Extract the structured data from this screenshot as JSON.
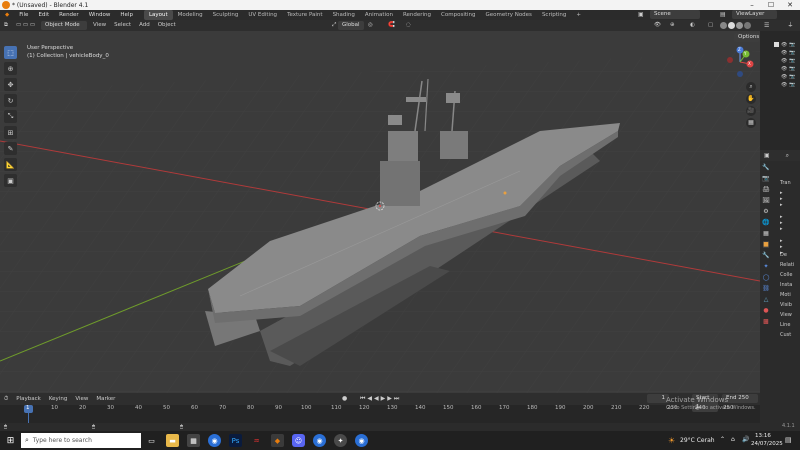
{
  "window": {
    "title": "* (Unsaved) - Blender 4.1",
    "min": "–",
    "max": "☐",
    "close": "✕"
  },
  "menus": [
    "File",
    "Edit",
    "Render",
    "Window",
    "Help"
  ],
  "workspaces": [
    "Layout",
    "Modeling",
    "Sculpting",
    "UV Editing",
    "Texture Paint",
    "Shading",
    "Animation",
    "Rendering",
    "Compositing",
    "Geometry Nodes",
    "Scripting"
  ],
  "active_workspace": "Layout",
  "scene": {
    "label": "Scene",
    "viewlayer": "ViewLayer"
  },
  "header": {
    "mode": "Object Mode",
    "view": "View",
    "select": "Select",
    "add": "Add",
    "object": "Object",
    "orientation": "Global",
    "options": "Options"
  },
  "viewport": {
    "perspective": "User Perspective",
    "collection": "(1) Collection | vehicleBody_0"
  },
  "gizmo": {
    "x": "X",
    "y": "Y",
    "z": "Z"
  },
  "timeline": {
    "playback": "Playback",
    "keying": "Keying",
    "view": "View",
    "marker": "Marker",
    "current_frame": "1",
    "start_label": "Start",
    "start": "1",
    "end_label": "End",
    "end": "250",
    "ticks": [
      "1",
      "10",
      "20",
      "30",
      "40",
      "50",
      "60",
      "70",
      "80",
      "90",
      "100",
      "110",
      "120",
      "130",
      "140",
      "150",
      "160",
      "170",
      "180",
      "190",
      "200",
      "210",
      "220",
      "230",
      "240",
      "250"
    ]
  },
  "watermark": {
    "line1": "Activate Windows",
    "line2": "Go to Settings to activate Windows."
  },
  "properties": {
    "sections": [
      "Tran",
      "De",
      "Relati",
      "Colle",
      "Insta",
      "Moti",
      "Visib",
      "View",
      "Line",
      "Cust"
    ]
  },
  "version": "4.1.1",
  "taskbar": {
    "search_placeholder": "Type here to search",
    "weather": "29°C  Cerah",
    "time": "13:16",
    "date": "24/07/2025"
  },
  "colors": {
    "accent": "#4772b3",
    "xaxis": "#b03a3a",
    "yaxis": "#6f9c2b",
    "blender": "#e87d0d"
  }
}
